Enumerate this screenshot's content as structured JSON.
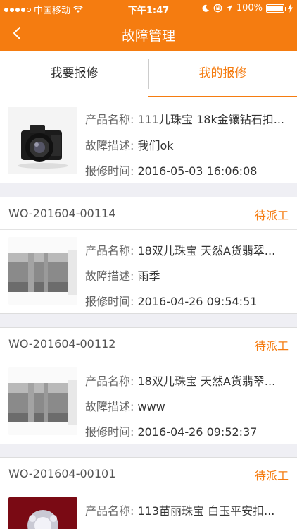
{
  "status_bar": {
    "carrier": "中国移动",
    "time": "下午1:47",
    "battery": "100%"
  },
  "nav": {
    "title": "故障管理"
  },
  "tabs": [
    {
      "label": "我要报修"
    },
    {
      "label": "我的报修"
    }
  ],
  "labels": {
    "product": "产品名称:",
    "desc": "故障描述:",
    "time": "报修时间:"
  },
  "cards": [
    {
      "wo": "",
      "status": "",
      "product": "111儿珠宝 18k金镶钻石扣...",
      "desc": "我们ok",
      "time": "2016-05-03 16:06:08"
    },
    {
      "wo": "WO-201604-00114",
      "status": "待派工",
      "product": "18双儿珠宝 天然A货翡翠...",
      "desc": "雨季",
      "time": "2016-04-26 09:54:51"
    },
    {
      "wo": "WO-201604-00112",
      "status": "待派工",
      "product": "18双儿珠宝 天然A货翡翠...",
      "desc": "www",
      "time": "2016-04-26 09:52:37"
    },
    {
      "wo": "WO-201604-00101",
      "status": "待派工",
      "product": "113苗丽珠宝 白玉平安扣...",
      "desc": "",
      "time": ""
    }
  ]
}
